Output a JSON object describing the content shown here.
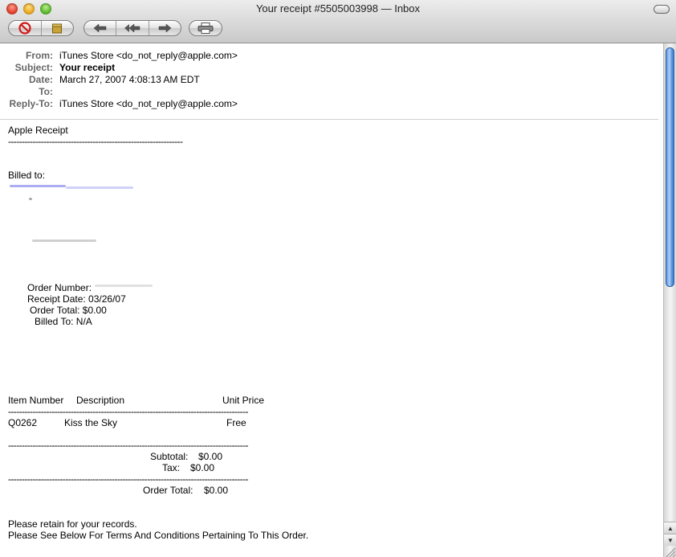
{
  "window": {
    "title": "Your receipt #5505003998 — Inbox"
  },
  "toolbar": {
    "buttons": [
      {
        "name": "delete",
        "icon": "no-entry-icon"
      },
      {
        "name": "junk",
        "icon": "junk-bin-icon"
      },
      {
        "name": "reply",
        "icon": "reply-arrow-icon"
      },
      {
        "name": "reply-all",
        "icon": "reply-all-arrow-icon"
      },
      {
        "name": "forward",
        "icon": "forward-arrow-icon"
      },
      {
        "name": "print",
        "icon": "printer-icon"
      }
    ]
  },
  "headers": {
    "from_label": "From:",
    "from": "iTunes Store <do_not_reply@apple.com>",
    "subject_label": "Subject:",
    "subject": "Your receipt",
    "date_label": "Date:",
    "date": "March 27, 2007 4:08:13 AM EDT",
    "to_label": "To:",
    "to": "",
    "replyto_label": "Reply-To:",
    "replyto": "iTunes Store <do_not_reply@apple.com>"
  },
  "body": {
    "title": "Apple Receipt",
    "dashes_short": "----------------------------------------------------------------",
    "billed_to_label": "Billed to:",
    "order_number_label": "Order Number:",
    "receipt_date_label": "Receipt Date: 03/26/07",
    "order_total_line": "Order Total: $0.00",
    "billed_to_line": "Billed To: N/A",
    "col_item_number": "Item Number",
    "col_description": "Description",
    "col_unit_price": "Unit Price",
    "dashes_long": "----------------------------------------------------------------------------------------",
    "items": [
      {
        "number": "Q0262",
        "description": "Kiss the Sky",
        "price": "Free"
      }
    ],
    "subtotal_label": "Subtotal:",
    "subtotal_value": "$0.00",
    "tax_label": "Tax:",
    "tax_value": "$0.00",
    "order_total_label": "Order Total:",
    "order_total_value": "$0.00",
    "footer_line1": "Please retain for your records.",
    "footer_line2": "Please See Below For Terms And Conditions Pertaining To This Order."
  },
  "colors": {
    "scroll_thumb": "#5b95e0",
    "header_label": "#666666",
    "redacted_link": "#2a2ad8"
  }
}
